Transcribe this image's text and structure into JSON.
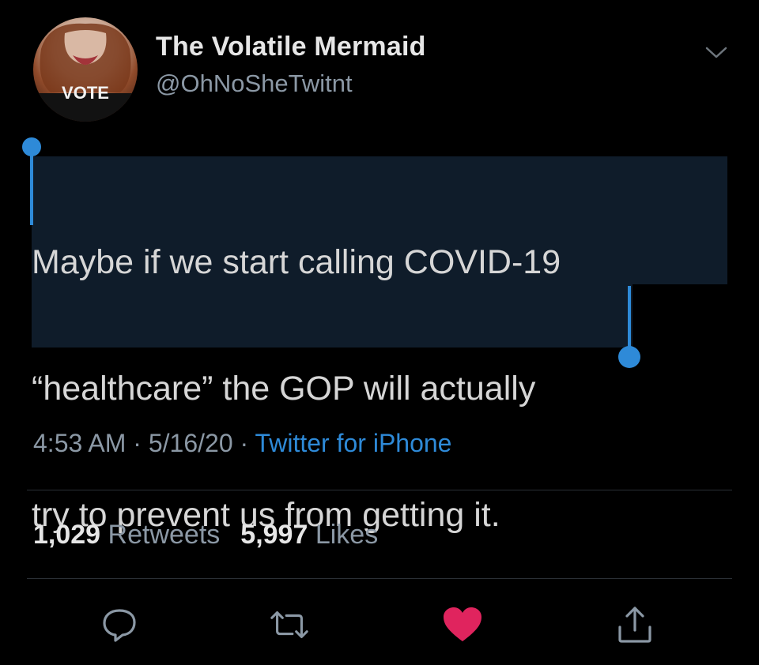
{
  "author": {
    "display_name": "The Volatile Mermaid",
    "handle": "@OhNoSheTwitnt",
    "avatar_text": "VOTE"
  },
  "tweet": {
    "lines": [
      "Maybe if we start calling COVID-19",
      "“healthcare” the GOP will actually",
      "try to prevent us from getting it."
    ]
  },
  "meta": {
    "time": "4:53 AM",
    "separator": " · ",
    "date": "5/16/20",
    "source": "Twitter for iPhone"
  },
  "stats": {
    "retweets_count": "1,029",
    "retweets_label": "Retweets",
    "likes_count": "5,997",
    "likes_label": "Likes"
  },
  "icons": {
    "reply": "reply-icon",
    "retweet": "retweet-icon",
    "like": "heart-icon",
    "share": "share-icon",
    "more": "chevron-down-icon"
  },
  "colors": {
    "background": "#000000",
    "link": "#2e8ad8",
    "like": "#e0245e",
    "selection": "#0f1c2a",
    "selection_handle": "#2e8ad8",
    "muted": "#8b98a5"
  }
}
